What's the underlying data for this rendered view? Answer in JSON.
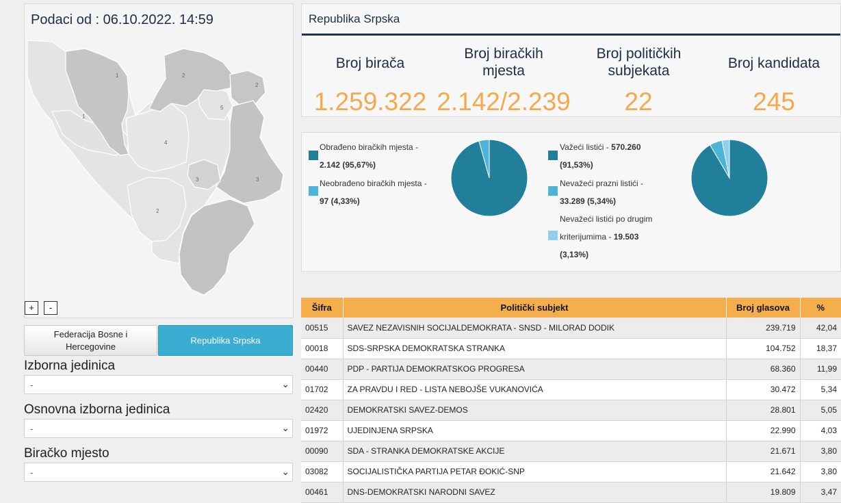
{
  "left": {
    "header": "Podaci od : 06.10.2022. 14:59",
    "map": {
      "region_labels": [
        "1",
        "2",
        "2",
        "5",
        "1",
        "4",
        "3",
        "3",
        "2"
      ],
      "zoom_in": "+",
      "zoom_out": "-"
    },
    "entity_tabs": [
      {
        "label": "Federacija Bosne i Hercegovine",
        "active": false
      },
      {
        "label": "Republika Srpska",
        "active": true
      }
    ],
    "filters": [
      {
        "label": "Izborna jedinica",
        "value": "-"
      },
      {
        "label": "Osnovna izborna jedinica",
        "value": "-"
      },
      {
        "label": "Biračko mjesto",
        "value": "-"
      }
    ]
  },
  "right": {
    "header": "Republika Srpska",
    "stats": [
      {
        "label": "Broj birača",
        "value": "1.259.322"
      },
      {
        "label": "Broj biračkih mjesta",
        "value": "2.142/2.239"
      },
      {
        "label": "Broj političkih subjekata",
        "value": "22"
      },
      {
        "label": "Broj kandidata",
        "value": "245"
      }
    ],
    "legend1": {
      "a_label": "Obrađeno biračkih mjesta -",
      "a_value": "2.142 (95,67%)",
      "b_label": "Neobrađeno biračkih mjesta -",
      "b_value": "97 (4,33%)"
    },
    "legend2": {
      "a_label": "Važeći listići -",
      "a_num": "570.260",
      "a_pct": "(91,53%)",
      "b_label": "Nevažeći prazni listići -",
      "b_value": "33.289 (5,34%)",
      "c_label1": "Nevažeći listići po drugim",
      "c_label2": "kriterijumima -",
      "c_num": "19.503",
      "c_pct": "(3,13%)"
    },
    "table": {
      "headers": [
        "Šifra",
        "Politički subjekt",
        "Broj glasova",
        "%"
      ],
      "rows": [
        [
          "00515",
          "SAVEZ NEZAVISNIH SOCIJALDEMOKRATA - SNSD - MILORAD DODIK",
          "239.719",
          "42,04"
        ],
        [
          "00018",
          "SDS-SRPSKA DEMOKRATSKA STRANKA",
          "104.752",
          "18,37"
        ],
        [
          "00440",
          "PDP - PARTIJA DEMOKRATSKOG PROGRESA",
          "68.360",
          "11,99"
        ],
        [
          "01702",
          "ZA PRAVDU I RED - LISTA NEBOJŠE VUKANOVIĆA",
          "30.472",
          "5,34"
        ],
        [
          "02420",
          "DEMOKRATSKI SAVEZ-DEMOS",
          "28.801",
          "5,05"
        ],
        [
          "01972",
          "UJEDINJENA SRPSKA",
          "22.990",
          "4,03"
        ],
        [
          "00090",
          "SDA - STRANKA DEMOKRATSKE AKCIJE",
          "21.671",
          "3,80"
        ],
        [
          "03082",
          "SOCIJALISTIČKA PARTIJA PETAR ĐOKIĆ-SNP",
          "21.642",
          "3,80"
        ],
        [
          "00461",
          "DNS-DEMOKRATSKI NARODNI SAVEZ",
          "19.809",
          "3,47"
        ]
      ]
    }
  },
  "chart_data": [
    {
      "type": "pie",
      "categories": [
        "Obrađeno biračkih mjesta",
        "Neobrađeno biračkih mjesta"
      ],
      "values": [
        95.67,
        4.33
      ],
      "colors": [
        "#227f9c",
        "#4bb4d8"
      ]
    },
    {
      "type": "pie",
      "categories": [
        "Važeći listići",
        "Nevažeći prazni listići",
        "Nevažeći listići po drugim kriterijumima"
      ],
      "values": [
        91.53,
        5.34,
        3.13
      ],
      "colors": [
        "#227f9c",
        "#4bb4d8",
        "#8fcfee"
      ]
    }
  ],
  "colors": {
    "accent_orange": "#f5a94d",
    "header_navy": "#1d3553",
    "pie_main": "#227f9c",
    "active_tab": "#3aaed2"
  }
}
